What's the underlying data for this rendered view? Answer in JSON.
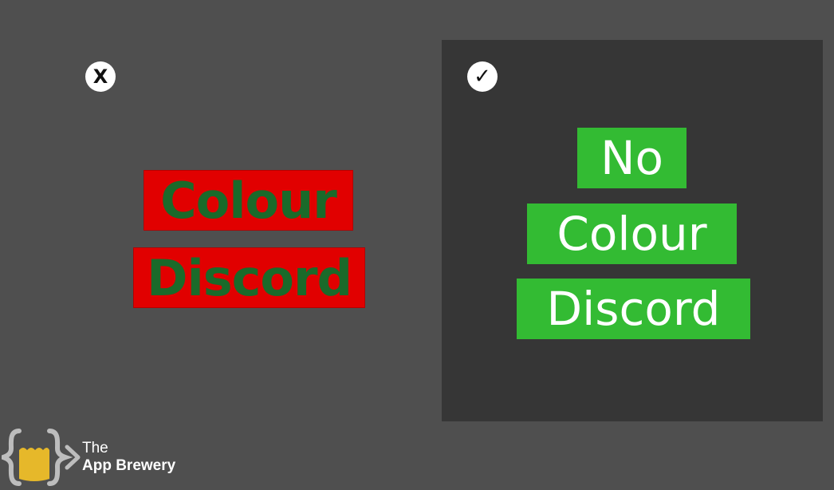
{
  "left_example": {
    "badge_symbol": "X",
    "words": [
      "Colour",
      "Discord"
    ],
    "background_color": "#e10000",
    "text_color": "#1a6a2a"
  },
  "right_example": {
    "badge_symbol": "✓",
    "words": [
      "No",
      "Colour",
      "Discord"
    ],
    "panel_color": "#363636",
    "background_color": "#33bb33",
    "text_color": "#ffffff"
  },
  "logo": {
    "line1": "The",
    "line2": "App Brewery",
    "icon": "curly-braces-cup-logo"
  }
}
